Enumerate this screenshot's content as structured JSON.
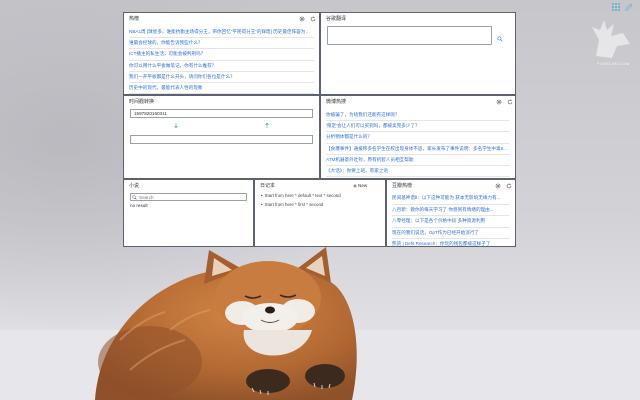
{
  "toolbar": {
    "apps_icon": "grid-icon",
    "edit_icon": "pencil-icon"
  },
  "watermark": {
    "text": "FOXELAN.COM"
  },
  "widgets": {
    "hot": {
      "title": "热榜",
      "items": [
        "NBA1周 [球星多，谁能抗衡主场得分王，带你回忆“平民得分王”的辉煌] 历史最佳阵容为何？",
        "谁最会控球的，你能告诉我些什么？",
        "ICT播主的私生活，可能会被判刑吗？",
        "你可以用什么平板做笔记，你有什么推荐？",
        "我们一开平板都是什么开头，请问你们各位是什么？",
        "历史中的现代，最能代表人性的现象"
      ]
    },
    "translate": {
      "title": "谷歌翻译"
    },
    "timestamp": {
      "title": "时间戳转换",
      "timestamp_value": "1597820160311"
    },
    "weibo": {
      "title": "微博热搜",
      "items": [
        "你被骗了，为啥我们还能有这样呢？",
        "'限定'会让人们可以买到吗，都被卖完多少了？",
        "分析物体都是什么的？",
        "【食爆事件】通报称多名学生在校出现身体不适，家长发布了事件说明：多名学生中毒66.5%",
        "ATM机器意外吐钞，原有机智人员相互帮助",
        "《大话》：你要上班，有家之语"
      ]
    },
    "novel": {
      "title": "小说",
      "search_placeholder": "Search",
      "empty_text": "no result"
    },
    "notes": {
      "title": "日记本",
      "new_label": "New",
      "items": [
        "Start from here * default * text * second",
        "Start from here * first * second"
      ]
    },
    "douban": {
      "title": "豆瓣热榜",
      "items": [
        "民间基神谱Ⅱ：以下这种可能为 获本无影响无缘力有...",
        "八月新：教你的每天学习了 你感到有情绪的理由...",
        "八零经理：以下是各个价格中段 多种资源利用",
        "现在的我们说话，OpT作为已经开始流行了",
        "熊货 | Defit Research：你玩的钱包都被这样子了"
      ]
    }
  },
  "colors": {
    "link": "#2f6fd6",
    "accent_icon": "#3b82d6",
    "widget_border": "#5d6270",
    "background": "#d3d3d7"
  }
}
